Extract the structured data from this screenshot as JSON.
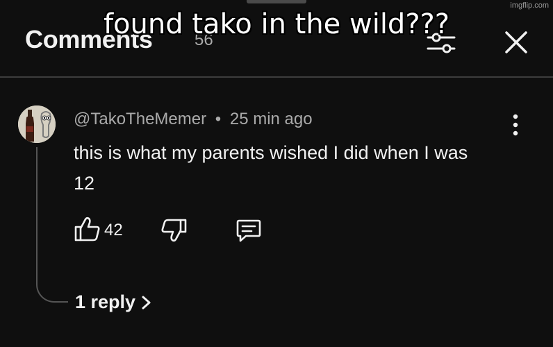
{
  "meme": {
    "caption": "found tako in the wild???",
    "watermark": "imgflip.com"
  },
  "header": {
    "title": "Comments",
    "count": "56",
    "filter_icon": "sort-filter-icon",
    "close_icon": "close-icon"
  },
  "comment": {
    "author": "@TakoTheMemer",
    "separator": "•",
    "time": "25 min ago",
    "text": "this is what my parents wished I did when I was 12",
    "likes": "42",
    "more_icon": "more-vertical-icon"
  },
  "replies": {
    "label": "1 reply"
  },
  "colors": {
    "background": "#0f0f0f",
    "text_primary": "#f1f1f1",
    "text_secondary": "#aaaaaa",
    "divider": "#3d3d3d"
  }
}
